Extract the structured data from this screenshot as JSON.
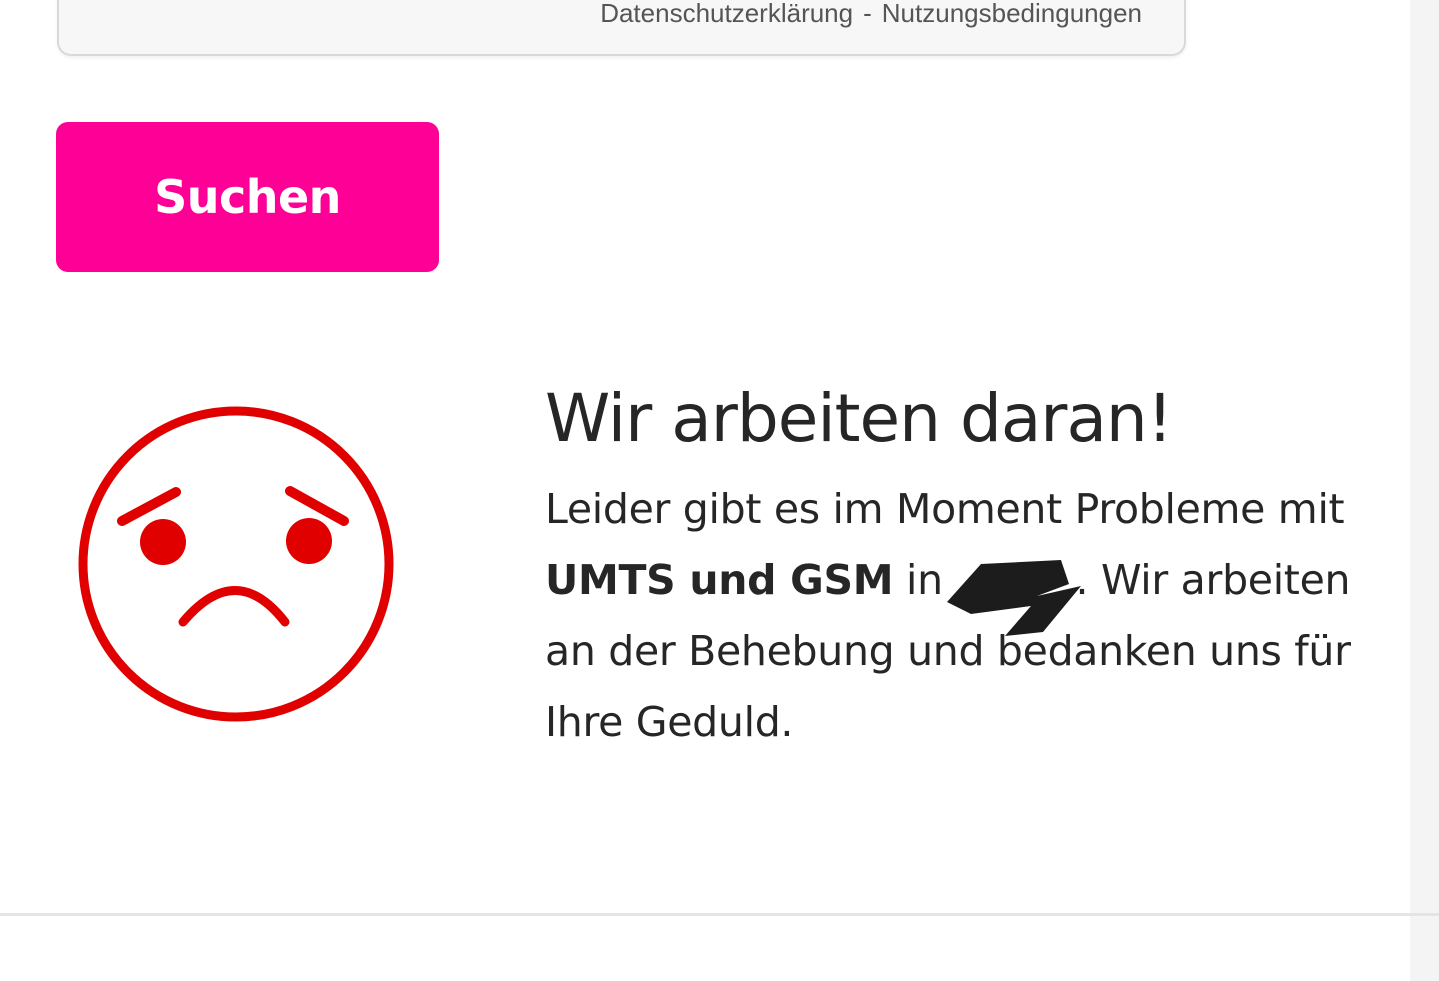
{
  "map_footer": {
    "privacy_link": "Datenschutzerklärung",
    "separator": "-",
    "terms_link": "Nutzungsbedingungen"
  },
  "search": {
    "button_label": "Suchen"
  },
  "status": {
    "icon": "sad-face-icon",
    "heading": "Wir arbeiten daran!",
    "text_intro": "Leider gibt es im Moment Probleme mit ",
    "text_bold": "UMTS und GSM",
    "text_in": " in ",
    "text_after_location": ". Wir arbeiten an der Behebung und bedanken uns für Ihre Geduld."
  },
  "colors": {
    "brand_magenta": "#ff0097",
    "alert_red": "#e00000",
    "text": "#262626"
  }
}
